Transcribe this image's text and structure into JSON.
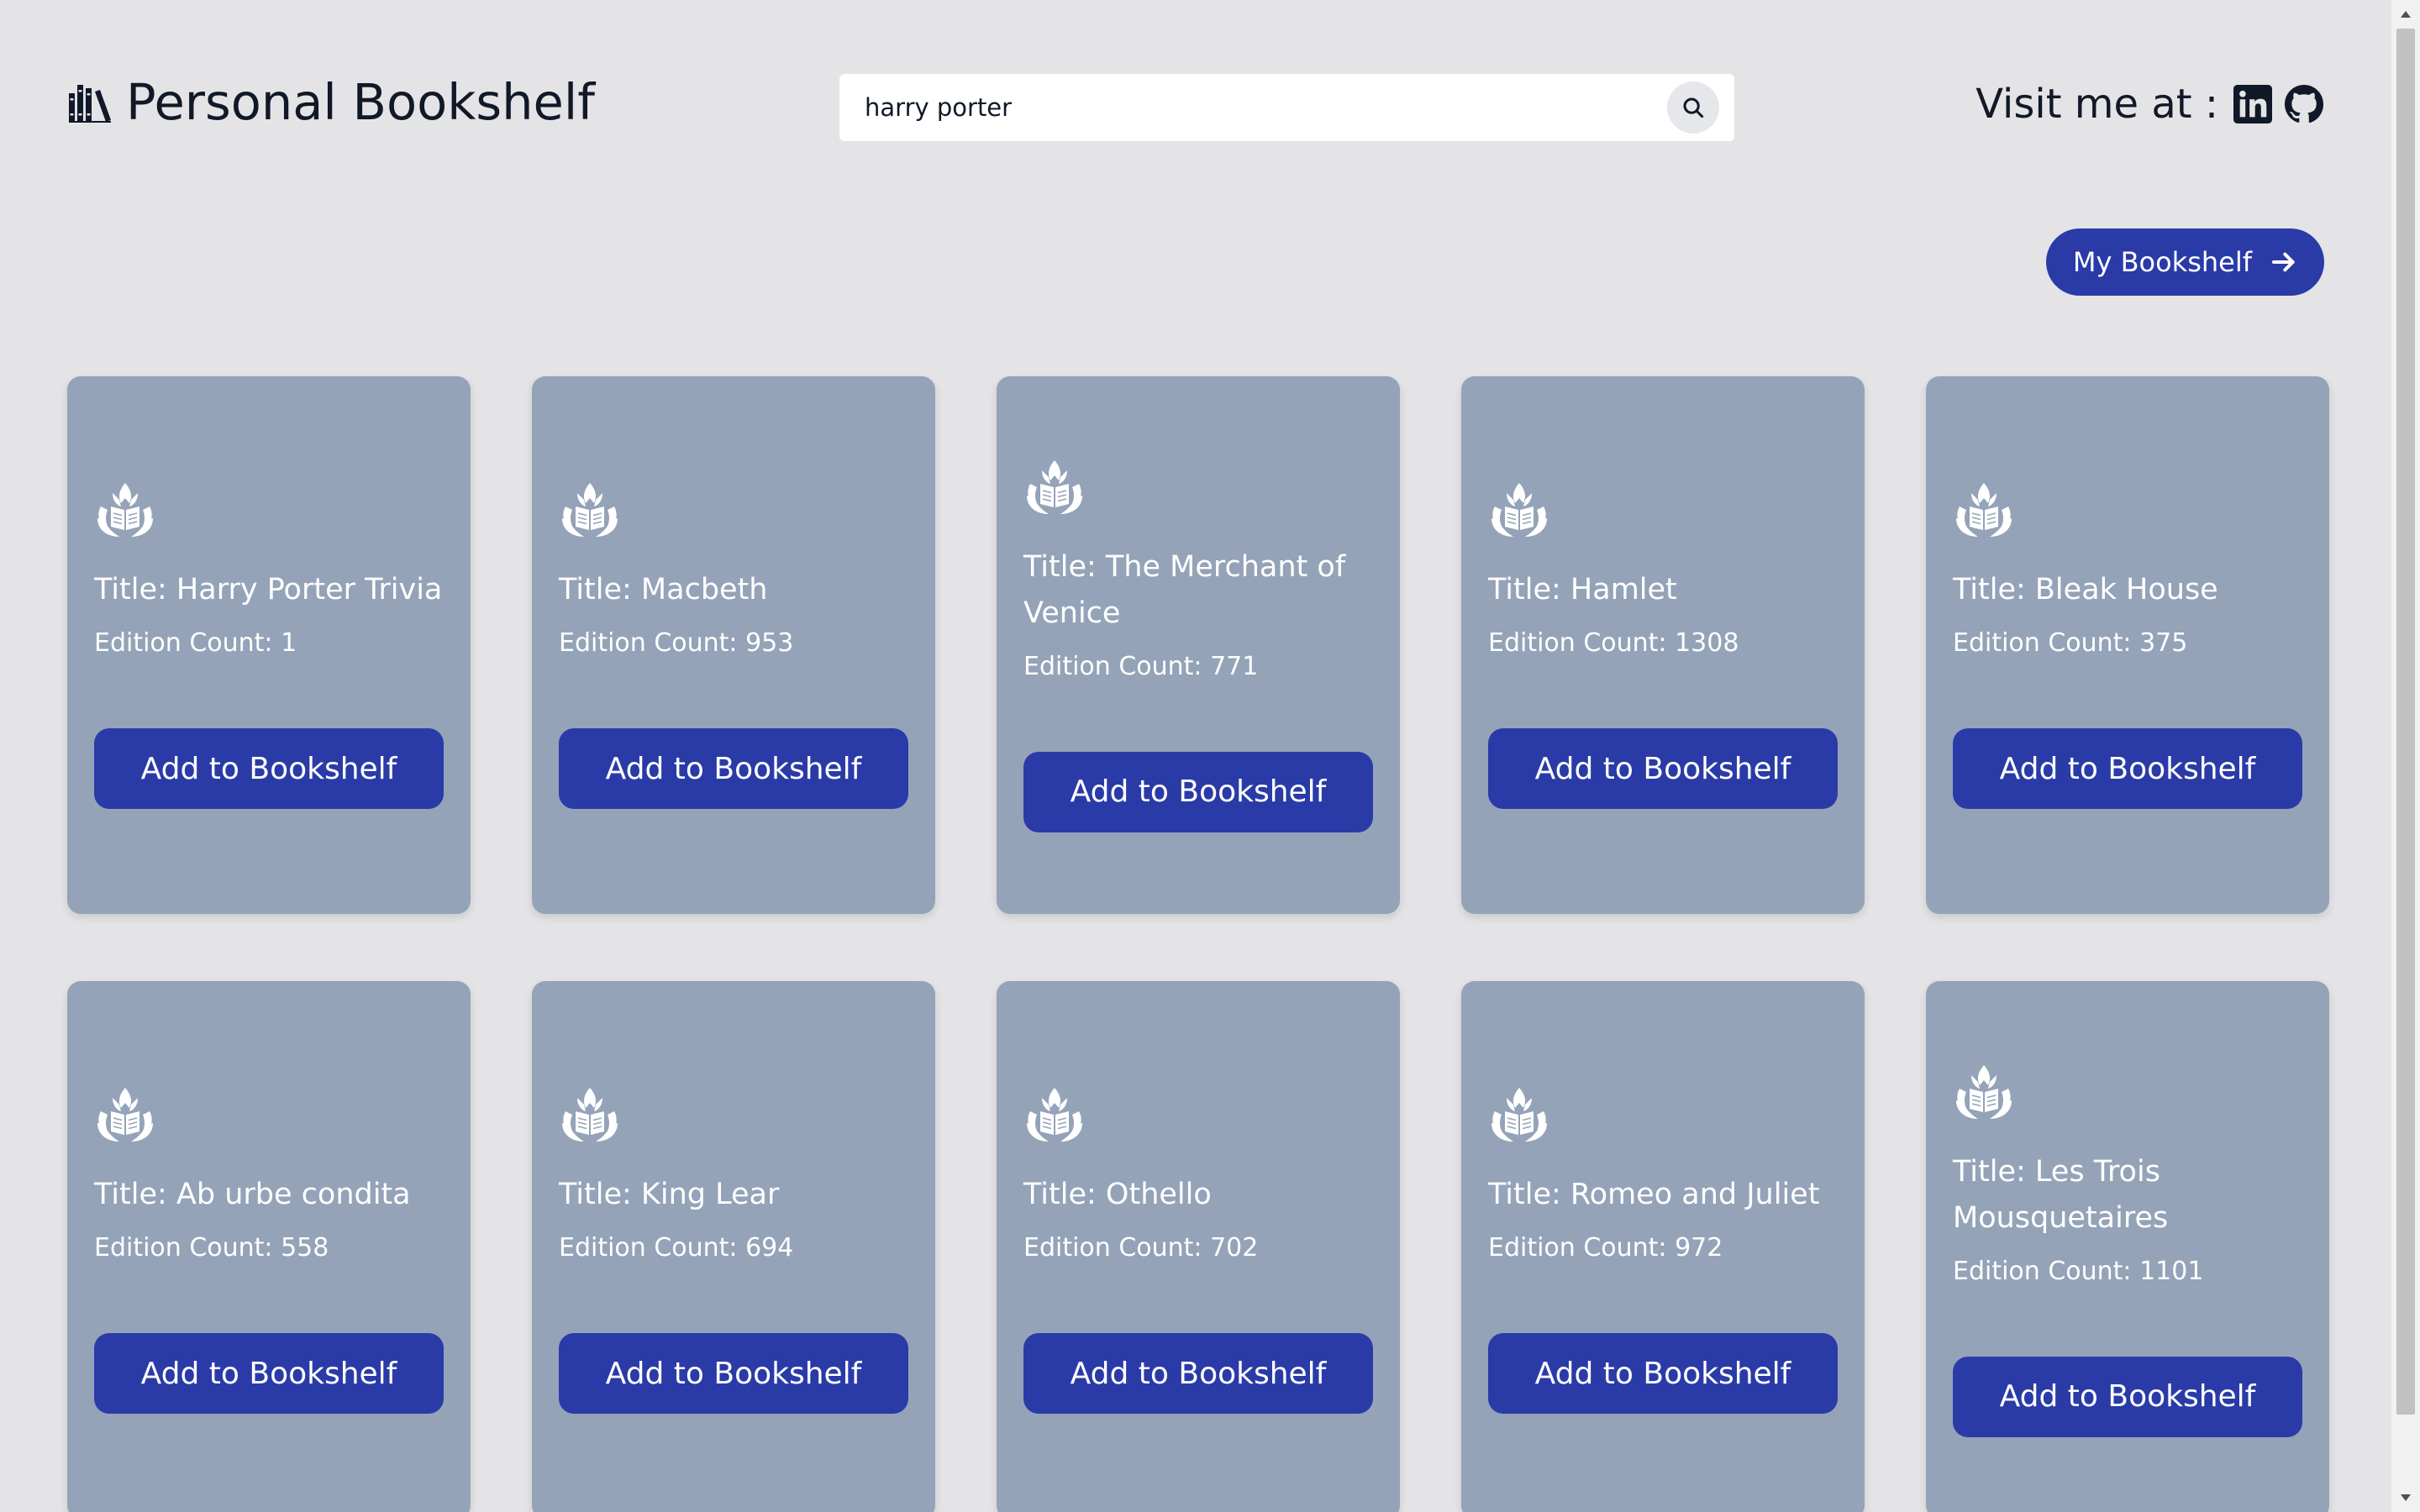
{
  "header": {
    "brand_title": "Personal Bookshelf",
    "brand_icon": "books-icon",
    "search": {
      "value": "harry porter",
      "placeholder": "Search books",
      "button_icon": "search-icon"
    },
    "social": {
      "label": "Visit me at :",
      "links": [
        {
          "icon": "linkedin-icon"
        },
        {
          "icon": "github-icon"
        }
      ]
    }
  },
  "my_bookshelf_button": {
    "label": "My Bookshelf",
    "icon": "arrow-right-icon"
  },
  "books": [
    {
      "title": "Title: Harry Porter Trivia",
      "count": "Edition Count: 1",
      "button": "Add to Bookshelf"
    },
    {
      "title": "Title: Macbeth",
      "count": "Edition Count: 953",
      "button": "Add to Bookshelf"
    },
    {
      "title": "Title: The Merchant of Venice",
      "count": "Edition Count: 771",
      "button": "Add to Bookshelf"
    },
    {
      "title": "Title: Hamlet",
      "count": "Edition Count: 1308",
      "button": "Add to Bookshelf"
    },
    {
      "title": "Title: Bleak House",
      "count": "Edition Count: 375",
      "button": "Add to Bookshelf"
    },
    {
      "title": "Title: Ab urbe condita",
      "count": "Edition Count: 558",
      "button": "Add to Bookshelf"
    },
    {
      "title": "Title: King Lear",
      "count": "Edition Count: 694",
      "button": "Add to Bookshelf"
    },
    {
      "title": "Title: Othello",
      "count": "Edition Count: 702",
      "button": "Add to Bookshelf"
    },
    {
      "title": "Title: Romeo and Juliet",
      "count": "Edition Count: 972",
      "button": "Add to Bookshelf"
    },
    {
      "title": "Title: Les Trois Mousquetaires",
      "count": "Edition Count: 1101",
      "button": "Add to Bookshelf"
    }
  ],
  "colors": {
    "background": "#e4e4e7",
    "card": "#94a3b8",
    "accent": "#2a3ba8",
    "text_dark": "#111827",
    "text_light": "#ffffff"
  }
}
